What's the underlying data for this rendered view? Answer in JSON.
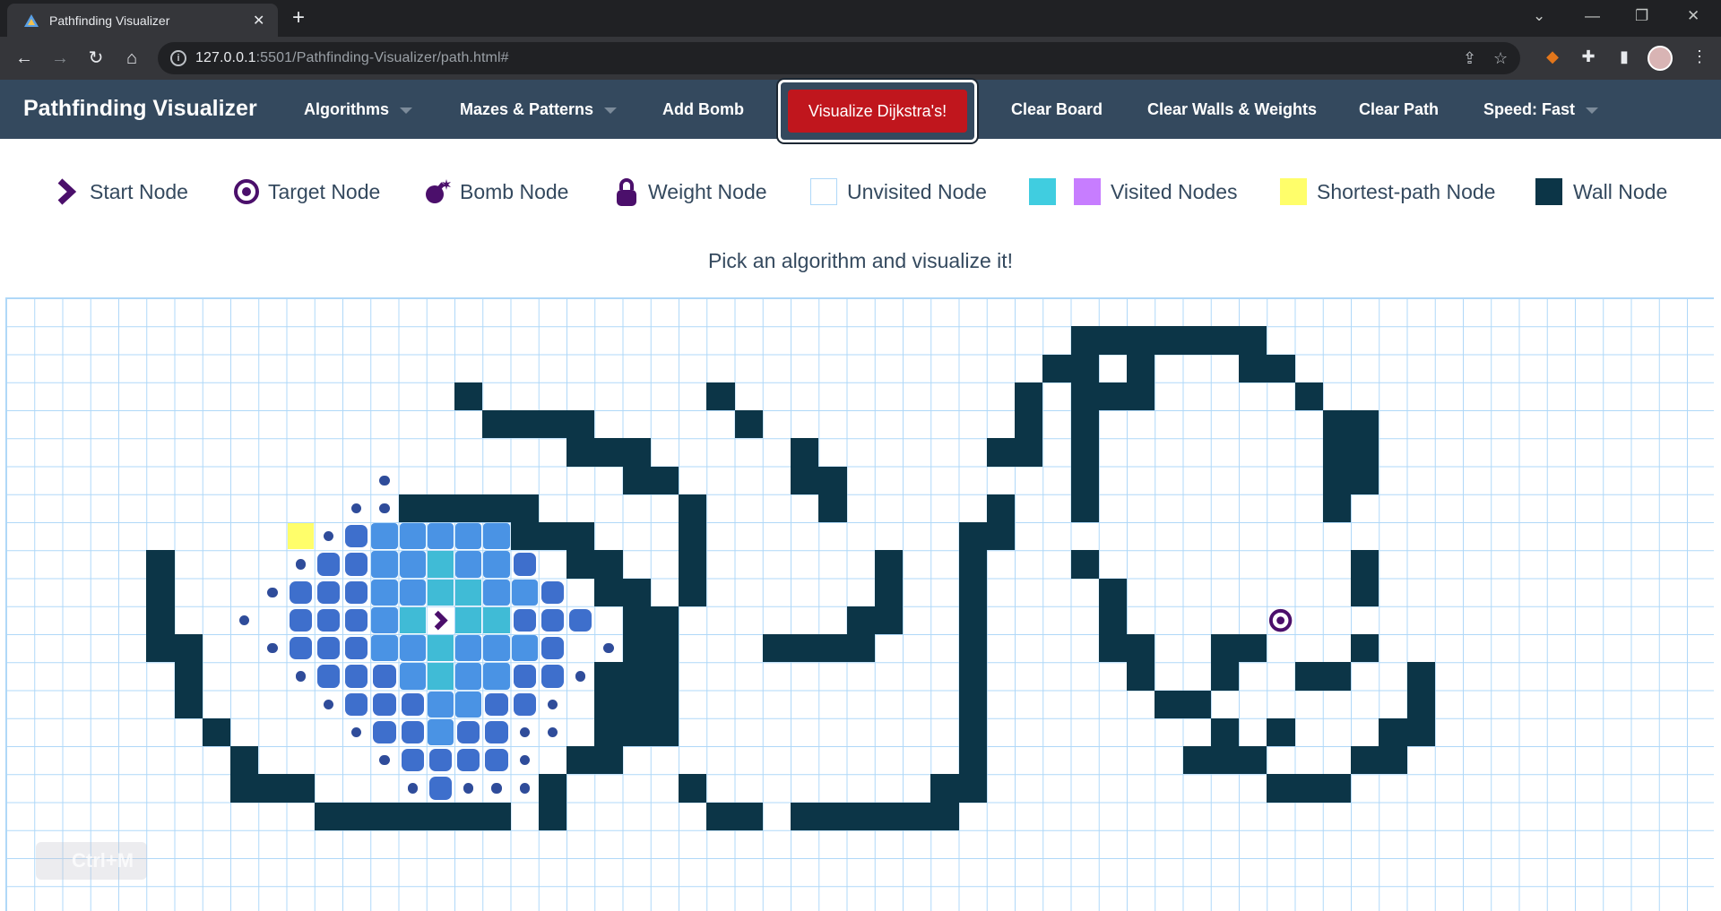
{
  "browser": {
    "tab_title": "Pathfinding Visualizer",
    "url_host": "127.0.0.1",
    "url_rest": ":5501/Pathfinding-Visualizer/path.html#"
  },
  "app": {
    "brand": "Pathfinding Visualizer",
    "nav": {
      "algorithms": "Algorithms",
      "mazes": "Mazes & Patterns",
      "add_bomb": "Add Bomb",
      "visualize": "Visualize Dijkstra's!",
      "clear_board": "Clear Board",
      "clear_walls": "Clear Walls & Weights",
      "clear_path": "Clear Path",
      "speed": "Speed: Fast"
    },
    "legend": {
      "start": "Start Node",
      "target": "Target Node",
      "bomb": "Bomb Node",
      "weight": "Weight Node",
      "unvisited": "Unvisited Node",
      "visited": "Visited Nodes",
      "shortest": "Shortest-path Node",
      "wall": "Wall Node"
    },
    "message": "Pick an algorithm and visualize it!",
    "overlay_hint": "Ctrl+M"
  },
  "colors": {
    "nav_bg": "#34495e",
    "visualize_red": "#c0161d",
    "wall": "#0c3547",
    "visited_teal": "#40bbd6",
    "visited_purple": "#c77dff",
    "shortest_path": "#fffe6a",
    "grid_line": "#afd8f8",
    "node_purple": "#4b0f6b"
  }
}
